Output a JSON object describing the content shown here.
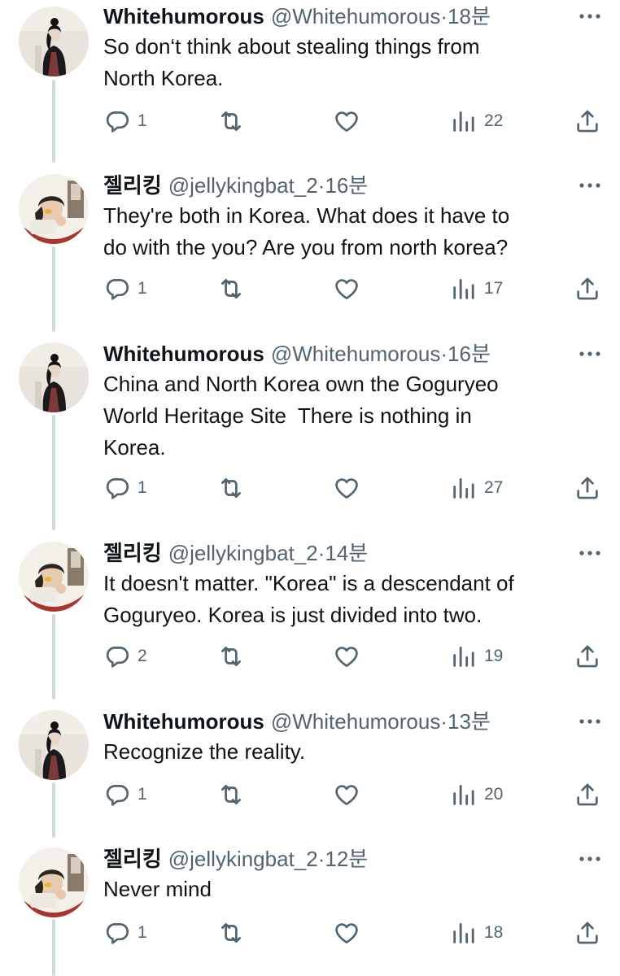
{
  "tweets": [
    {
      "author": "whitehumorous",
      "name": "Whitehumorous",
      "handle": "@Whitehumorous",
      "time": "18분",
      "text": "So don‘t think about stealing things from\nNorth Korea.",
      "replies": "1",
      "views": "22"
    },
    {
      "author": "jellyking",
      "name": "젤리킹",
      "handle": "@jellykingbat_2",
      "time": "16분",
      "text": "They're both in Korea. What does it have to\ndo with the you? Are you from north korea?",
      "replies": "1",
      "views": "17"
    },
    {
      "author": "whitehumorous",
      "name": "Whitehumorous",
      "handle": "@Whitehumorous",
      "time": "16분",
      "text": "China and North Korea own the Goguryeo\nWorld Heritage Site  There is nothing in\nKorea.",
      "replies": "1",
      "views": "27"
    },
    {
      "author": "jellyking",
      "name": "젤리킹",
      "handle": "@jellykingbat_2",
      "time": "14분",
      "text": "It doesn't matter. \"Korea\" is a descendant of\nGoguryeo. Korea is just divided into two.",
      "replies": "2",
      "views": "19"
    },
    {
      "author": "whitehumorous",
      "name": "Whitehumorous",
      "handle": "@Whitehumorous",
      "time": "13분",
      "text": "Recognize the reality.",
      "replies": "1",
      "views": "20"
    },
    {
      "author": "jellyking",
      "name": "젤리킹",
      "handle": "@jellykingbat_2",
      "time": "12분",
      "text": "Never mind",
      "replies": "1",
      "views": "18"
    }
  ],
  "separator": "·",
  "icons": {
    "reply": "reply-icon",
    "retweet": "retweet-icon",
    "like": "heart-icon",
    "views": "views-chart-icon",
    "share": "share-icon",
    "more": "more-dots-icon"
  },
  "colors": {
    "text": "#0f1419",
    "secondary": "#536471",
    "thread_line": "#cfd9de",
    "background": "#ffffff"
  }
}
